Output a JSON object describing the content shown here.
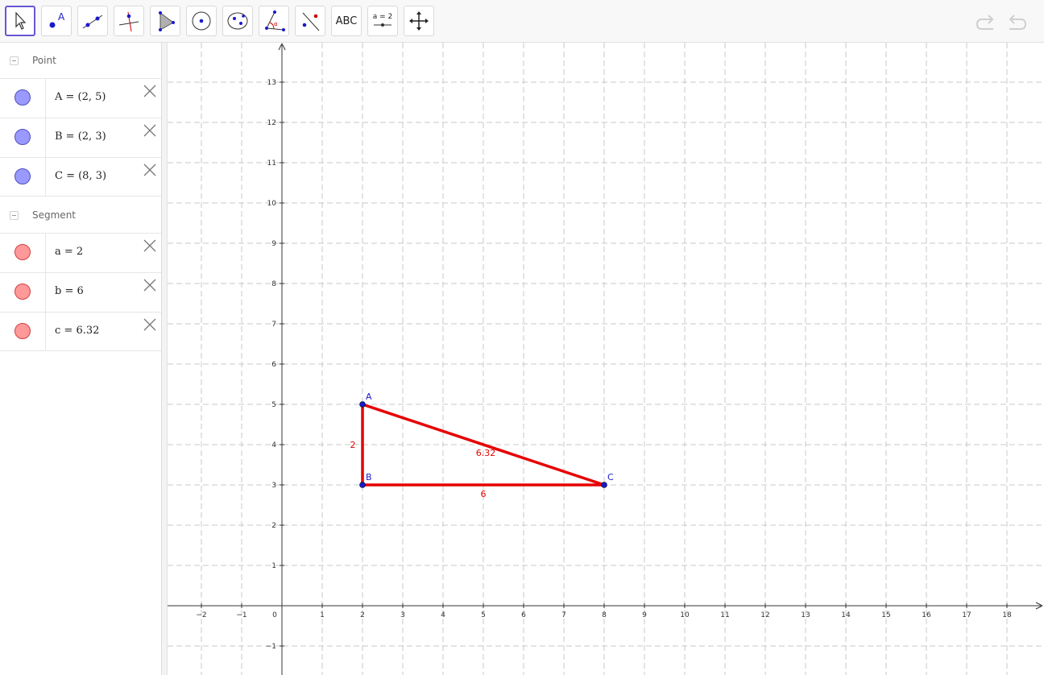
{
  "toolbar": {
    "tools": [
      {
        "name": "move-tool",
        "icon": "cursor-arrow-icon",
        "selected": true
      },
      {
        "name": "point-tool",
        "icon": "point-icon",
        "label": "A"
      },
      {
        "name": "line-tool",
        "icon": "line-icon"
      },
      {
        "name": "perpendicular-line-tool",
        "icon": "perpendicular-icon"
      },
      {
        "name": "polygon-tool",
        "icon": "polygon-icon"
      },
      {
        "name": "circle-tool",
        "icon": "circle-center-icon"
      },
      {
        "name": "conic-tool",
        "icon": "ellipse-icon"
      },
      {
        "name": "angle-tool",
        "icon": "angle-icon",
        "label": "α"
      },
      {
        "name": "reflect-tool",
        "icon": "reflect-icon"
      },
      {
        "name": "text-tool",
        "icon": "text-icon",
        "label": "ABC"
      },
      {
        "name": "slider-tool",
        "icon": "slider-icon",
        "label": "a = 2"
      },
      {
        "name": "move-graphics-tool",
        "icon": "move-arrows-icon"
      }
    ],
    "undo_icon": "undo-icon",
    "redo_icon": "redo-icon"
  },
  "algebra": {
    "groups": [
      {
        "label": "Point",
        "items": [
          {
            "expr": "A = (2, 5)",
            "color": "#9999ff"
          },
          {
            "expr": "B = (2, 3)",
            "color": "#9999ff"
          },
          {
            "expr": "C = (8, 3)",
            "color": "#9999ff"
          }
        ]
      },
      {
        "label": "Segment",
        "items": [
          {
            "expr": "a = 2",
            "color": "#ff9999"
          },
          {
            "expr": "b = 6",
            "color": "#ff9999"
          },
          {
            "expr": "c = 6.32",
            "color": "#ff9999"
          }
        ]
      }
    ]
  },
  "graphics": {
    "x_ticks": [
      -2,
      -1,
      0,
      1,
      2,
      3,
      4,
      5,
      6,
      7,
      8,
      9,
      10,
      11,
      12,
      13,
      14,
      15,
      16,
      17,
      18
    ],
    "y_ticks": [
      -1,
      1,
      2,
      3,
      4,
      5,
      6,
      7,
      8,
      9,
      10,
      11,
      12,
      13
    ],
    "x_tick_labels": [
      "−2",
      "−1",
      "0",
      "1",
      "2",
      "3",
      "4",
      "5",
      "6",
      "7",
      "8",
      "9",
      "10",
      "11",
      "12",
      "13",
      "14",
      "15",
      "16",
      "17",
      "18"
    ],
    "y_tick_labels": [
      "−1",
      "1",
      "2",
      "3",
      "4",
      "5",
      "6",
      "7",
      "8",
      "9",
      "10",
      "11",
      "12",
      "13"
    ],
    "points": [
      {
        "name": "A",
        "x": 2,
        "y": 5
      },
      {
        "name": "B",
        "x": 2,
        "y": 3
      },
      {
        "name": "C",
        "x": 8,
        "y": 3
      }
    ],
    "segments": [
      {
        "from": "A",
        "to": "B",
        "label": "2"
      },
      {
        "from": "B",
        "to": "C",
        "label": "6"
      },
      {
        "from": "A",
        "to": "C",
        "label": "6.32"
      }
    ],
    "point_color": "#1a1acc",
    "segment_color": "#e60000",
    "grid_color": "#c8c8c8"
  }
}
